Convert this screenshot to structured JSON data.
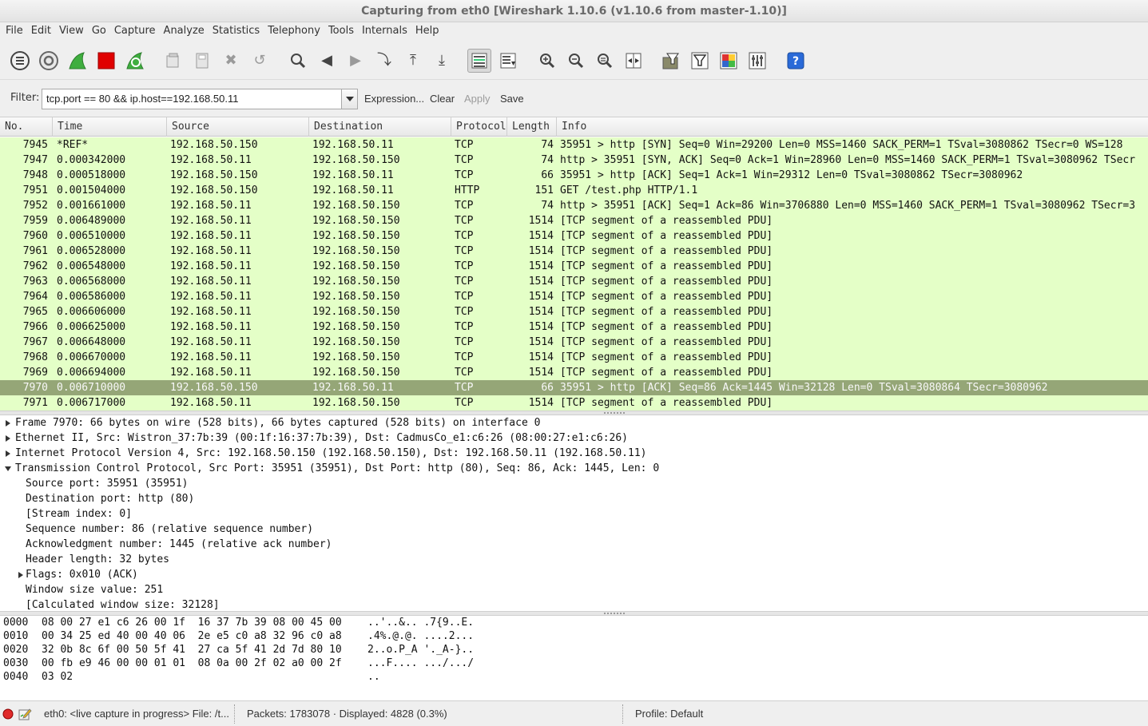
{
  "window": {
    "title": "Capturing from eth0   [Wireshark 1.10.6  (v1.10.6 from master-1.10)]"
  },
  "menu": [
    "File",
    "Edit",
    "View",
    "Go",
    "Capture",
    "Analyze",
    "Statistics",
    "Telephony",
    "Tools",
    "Internals",
    "Help"
  ],
  "toolbar": {
    "icons": [
      "interfaces-icon",
      "capture-options-icon",
      "start-capture-icon",
      "stop-capture-icon",
      "restart-capture-icon",
      "open-file-icon",
      "save-file-icon",
      "close-file-icon",
      "reload-icon",
      "find-packet-icon",
      "go-back-icon",
      "go-forward-icon",
      "go-to-packet-icon",
      "go-first-icon",
      "go-last-icon",
      "colorize-icon",
      "auto-scroll-icon",
      "zoom-in-icon",
      "zoom-out-icon",
      "normal-size-icon",
      "resize-columns-icon",
      "capture-filters-icon",
      "display-filters-icon",
      "coloring-rules-icon",
      "preferences-icon",
      "help-icon"
    ]
  },
  "filter": {
    "label": "Filter:",
    "value": "tcp.port == 80 && ip.host==192.168.50.11",
    "expression_label": "Expression...",
    "clear_label": "Clear",
    "apply_label": "Apply",
    "save_label": "Save"
  },
  "packet_list": {
    "columns": [
      "No.",
      "Time",
      "Source",
      "Destination",
      "Protocol",
      "Length",
      "Info"
    ],
    "rows": [
      {
        "no": "7945",
        "time": "*REF*",
        "src": "192.168.50.150",
        "dst": "192.168.50.11",
        "proto": "TCP",
        "len": "74",
        "info": "35951 > http [SYN] Seq=0 Win=29200 Len=0 MSS=1460 SACK_PERM=1 TSval=3080862 TSecr=0 WS=128"
      },
      {
        "no": "7947",
        "time": "0.000342000",
        "src": "192.168.50.11",
        "dst": "192.168.50.150",
        "proto": "TCP",
        "len": "74",
        "info": "http > 35951 [SYN, ACK] Seq=0 Ack=1 Win=28960 Len=0 MSS=1460 SACK_PERM=1 TSval=3080962 TSecr"
      },
      {
        "no": "7948",
        "time": "0.000518000",
        "src": "192.168.50.150",
        "dst": "192.168.50.11",
        "proto": "TCP",
        "len": "66",
        "info": "35951 > http [ACK] Seq=1 Ack=1 Win=29312 Len=0 TSval=3080862 TSecr=3080962"
      },
      {
        "no": "7951",
        "time": "0.001504000",
        "src": "192.168.50.150",
        "dst": "192.168.50.11",
        "proto": "HTTP",
        "len": "151",
        "info": "GET /test.php HTTP/1.1"
      },
      {
        "no": "7952",
        "time": "0.001661000",
        "src": "192.168.50.11",
        "dst": "192.168.50.150",
        "proto": "TCP",
        "len": "74",
        "info": "http > 35951 [ACK] Seq=1 Ack=86 Win=3706880 Len=0 MSS=1460 SACK_PERM=1 TSval=3080962 TSecr=3"
      },
      {
        "no": "7959",
        "time": "0.006489000",
        "src": "192.168.50.11",
        "dst": "192.168.50.150",
        "proto": "TCP",
        "len": "1514",
        "info": "[TCP segment of a reassembled PDU]"
      },
      {
        "no": "7960",
        "time": "0.006510000",
        "src": "192.168.50.11",
        "dst": "192.168.50.150",
        "proto": "TCP",
        "len": "1514",
        "info": "[TCP segment of a reassembled PDU]"
      },
      {
        "no": "7961",
        "time": "0.006528000",
        "src": "192.168.50.11",
        "dst": "192.168.50.150",
        "proto": "TCP",
        "len": "1514",
        "info": "[TCP segment of a reassembled PDU]"
      },
      {
        "no": "7962",
        "time": "0.006548000",
        "src": "192.168.50.11",
        "dst": "192.168.50.150",
        "proto": "TCP",
        "len": "1514",
        "info": "[TCP segment of a reassembled PDU]"
      },
      {
        "no": "7963",
        "time": "0.006568000",
        "src": "192.168.50.11",
        "dst": "192.168.50.150",
        "proto": "TCP",
        "len": "1514",
        "info": "[TCP segment of a reassembled PDU]"
      },
      {
        "no": "7964",
        "time": "0.006586000",
        "src": "192.168.50.11",
        "dst": "192.168.50.150",
        "proto": "TCP",
        "len": "1514",
        "info": "[TCP segment of a reassembled PDU]"
      },
      {
        "no": "7965",
        "time": "0.006606000",
        "src": "192.168.50.11",
        "dst": "192.168.50.150",
        "proto": "TCP",
        "len": "1514",
        "info": "[TCP segment of a reassembled PDU]"
      },
      {
        "no": "7966",
        "time": "0.006625000",
        "src": "192.168.50.11",
        "dst": "192.168.50.150",
        "proto": "TCP",
        "len": "1514",
        "info": "[TCP segment of a reassembled PDU]"
      },
      {
        "no": "7967",
        "time": "0.006648000",
        "src": "192.168.50.11",
        "dst": "192.168.50.150",
        "proto": "TCP",
        "len": "1514",
        "info": "[TCP segment of a reassembled PDU]"
      },
      {
        "no": "7968",
        "time": "0.006670000",
        "src": "192.168.50.11",
        "dst": "192.168.50.150",
        "proto": "TCP",
        "len": "1514",
        "info": "[TCP segment of a reassembled PDU]"
      },
      {
        "no": "7969",
        "time": "0.006694000",
        "src": "192.168.50.11",
        "dst": "192.168.50.150",
        "proto": "TCP",
        "len": "1514",
        "info": "[TCP segment of a reassembled PDU]"
      },
      {
        "no": "7970",
        "time": "0.006710000",
        "src": "192.168.50.150",
        "dst": "192.168.50.11",
        "proto": "TCP",
        "len": "66",
        "info": "35951 > http [ACK] Seq=86 Ack=1445 Win=32128 Len=0 TSval=3080864 TSecr=3080962"
      },
      {
        "no": "7971",
        "time": "0.006717000",
        "src": "192.168.50.11",
        "dst": "192.168.50.150",
        "proto": "TCP",
        "len": "1514",
        "info": "[TCP segment of a reassembled PDU]"
      }
    ],
    "selected_no": "7970"
  },
  "details": [
    {
      "text": "Frame 7970: 66 bytes on wire (528 bits), 66 bytes captured (528 bits) on interface 0",
      "level": 0,
      "expander": "collapsed"
    },
    {
      "text": "Ethernet II, Src: Wistron_37:7b:39 (00:1f:16:37:7b:39), Dst: CadmusCo_e1:c6:26 (08:00:27:e1:c6:26)",
      "level": 0,
      "expander": "collapsed"
    },
    {
      "text": "Internet Protocol Version 4, Src: 192.168.50.150 (192.168.50.150), Dst: 192.168.50.11 (192.168.50.11)",
      "level": 0,
      "expander": "collapsed"
    },
    {
      "text": "Transmission Control Protocol, Src Port: 35951 (35951), Dst Port: http (80), Seq: 86, Ack: 1445, Len: 0",
      "level": 0,
      "expander": "expanded"
    },
    {
      "text": "Source port: 35951 (35951)",
      "level": 1,
      "expander": "none"
    },
    {
      "text": "Destination port: http (80)",
      "level": 1,
      "expander": "none"
    },
    {
      "text": "[Stream index: 0]",
      "level": 1,
      "expander": "none"
    },
    {
      "text": "Sequence number: 86    (relative sequence number)",
      "level": 1,
      "expander": "none"
    },
    {
      "text": "Acknowledgment number: 1445    (relative ack number)",
      "level": 1,
      "expander": "none"
    },
    {
      "text": "Header length: 32 bytes",
      "level": 1,
      "expander": "none"
    },
    {
      "text": "Flags: 0x010 (ACK)",
      "level": 1,
      "expander": "collapsed"
    },
    {
      "text": "Window size value: 251",
      "level": 1,
      "expander": "none"
    },
    {
      "text": "[Calculated window size: 32128]",
      "level": 1,
      "expander": "none"
    }
  ],
  "hex": [
    {
      "offset": "0000",
      "bytes": "08 00 27 e1 c6 26 00 1f  16 37 7b 39 08 00 45 00",
      "ascii": "..'..&.. .7{9..E."
    },
    {
      "offset": "0010",
      "bytes": "00 34 25 ed 40 00 40 06  2e e5 c0 a8 32 96 c0 a8",
      "ascii": ".4%.@.@. ....2..."
    },
    {
      "offset": "0020",
      "bytes": "32 0b 8c 6f 00 50 5f 41  27 ca 5f 41 2d 7d 80 10",
      "ascii": "2..o.P_A '._A-}.."
    },
    {
      "offset": "0030",
      "bytes": "00 fb e9 46 00 00 01 01  08 0a 00 2f 02 a0 00 2f",
      "ascii": "...F.... .../.../"
    },
    {
      "offset": "0040",
      "bytes": "03 02",
      "ascii": ".."
    }
  ],
  "status": {
    "capture_info": "eth0: <live capture in progress> File: /t...",
    "packets": "Packets: 1783078 · Displayed: 4828 (0.3%)",
    "profile": "Profile: Default"
  },
  "colors": {
    "row_bg": "#e4ffc7",
    "selected_bg": "#95a677",
    "help_blue": "#2a6ad8",
    "stop_red": "#e00000",
    "shark_green": "#3fae3f"
  }
}
